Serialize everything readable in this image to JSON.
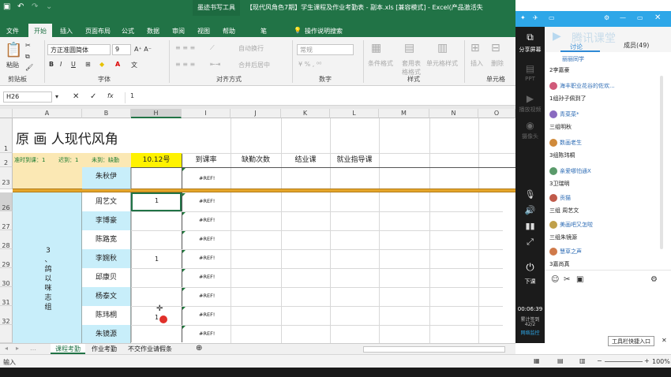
{
  "excel": {
    "title": "【现代风角色7期】学生课程及作业考勤表 - 副本.xls [兼容模式] - Excel(产品激活失",
    "context_tab": "墨迹书写工具",
    "tabs": [
      "文件",
      "开始",
      "插入",
      "页面布局",
      "公式",
      "数据",
      "审阅",
      "视图",
      "帮助",
      "笔"
    ],
    "active_tab": "开始",
    "tell_me": "操作说明搜索",
    "ribbon": {
      "paste": "粘贴",
      "clipboard": "剪贴板",
      "font_name": "方正准圆简体",
      "font_size": "9",
      "font_group": "字体",
      "wrap": "自动换行",
      "merge": "合并后居中",
      "align_group": "对齐方式",
      "number_format": "常规",
      "number_group": "数字",
      "cond_format": "条件格式",
      "table_format": "套用表格格式",
      "cell_style": "单元格样式",
      "style_group": "样式",
      "insert": "插入",
      "delete": "删除",
      "cells_group": "单元格"
    },
    "name_box": "H26",
    "formula": "1",
    "columns": [
      "A",
      "B",
      "H",
      "I",
      "J",
      "K",
      "L",
      "M",
      "N",
      "O"
    ],
    "rows": [
      "1",
      "2",
      "23",
      "26",
      "27",
      "28",
      "29",
      "30",
      "31",
      "32"
    ],
    "sheet_title": "原 画 人现代风角",
    "row2": {
      "on_time": "准时到课：1",
      "late": "迟到：1",
      "absent": "未到：缺勤",
      "date": "10.12号",
      "headers": [
        "到课率",
        "缺勤次数",
        "结业课",
        "就业指导课"
      ]
    },
    "group_label": [
      "3",
      "、",
      "鸽",
      "以",
      "咪",
      "志",
      "组"
    ],
    "names": [
      "朱秋伊",
      "周艺文",
      "李博豪",
      "陈路宽",
      "李婉秋",
      "邱康贝",
      "杨泰文",
      "陈玮桐",
      "朱镜源"
    ],
    "h_values": [
      "",
      "1",
      "",
      "",
      "1",
      "",
      "",
      "1",
      ""
    ],
    "ref_error": "#REF!",
    "sheet_tabs": [
      "课程考勤",
      "作业考勤",
      "不交作业请假条"
    ],
    "active_sheet": "课程考勤",
    "status_mode": "输入",
    "zoom": "100%"
  },
  "panel": {
    "tab_discuss": "讨论",
    "tab_online": "成员(49)",
    "left_icons": [
      "分享屏幕",
      "PPT",
      "播放视频",
      "摄像头",
      "下课"
    ],
    "timer": "00:06:39",
    "timer_sub": "累计签到",
    "timer_count": "42/2",
    "network": "网络监控",
    "brand": "腾讯课堂",
    "messages": [
      {
        "who": "丽丽同学",
        "text": "",
        "color": "#7aa0c8"
      },
      {
        "who": "",
        "text": "2李嘉豪",
        "color": ""
      },
      {
        "who": "海丰职业花谷的佐欢...",
        "text": "1组孙子佩到了",
        "color": "#d05a7a"
      },
      {
        "who": "青菜菜*",
        "text": "三组明秋",
        "color": "#8a6ac0"
      },
      {
        "who": "数画老生",
        "text": "3组陈玮桐",
        "color": "#d08a3a"
      },
      {
        "who": "亲爱哪怕通X",
        "text": "3卫瑞明",
        "color": "#5a9a6a"
      },
      {
        "who": "贡猫",
        "text": "三组 周艺文",
        "color": "#c05a4a"
      },
      {
        "who": "美画吧又怎啦",
        "text": "三组朱镜源",
        "color": "#c0a04a"
      },
      {
        "who": "慧草之声",
        "text": "3嘉尚真",
        "color": "#d07a4a"
      }
    ],
    "tooltip": "工具栏快捷入口"
  }
}
